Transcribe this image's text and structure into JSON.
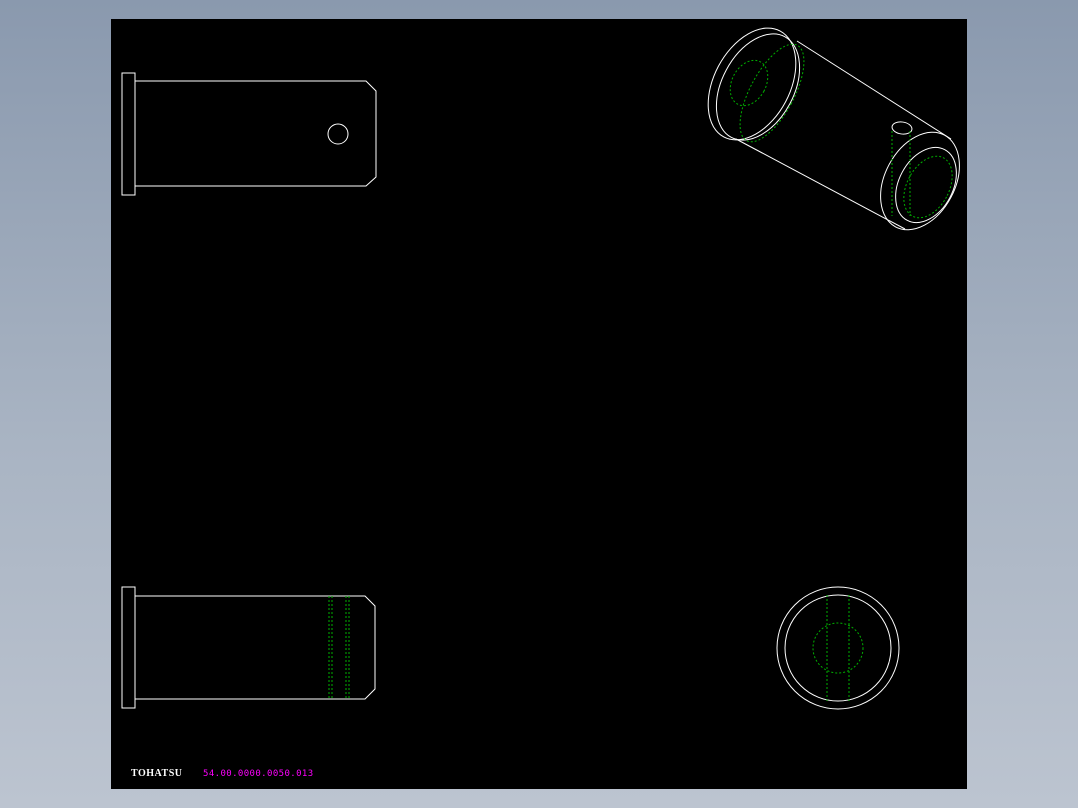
{
  "drawing": {
    "logo_text": "TOHATSU",
    "part_number": "54.00.0000.0050.013"
  },
  "colors": {
    "background": "#000000",
    "outline": "#ffffff",
    "hidden_line": "#00b000",
    "part_number_text": "#ff00ff"
  },
  "views": [
    "top-view",
    "front-view",
    "isometric-view",
    "end-view"
  ]
}
